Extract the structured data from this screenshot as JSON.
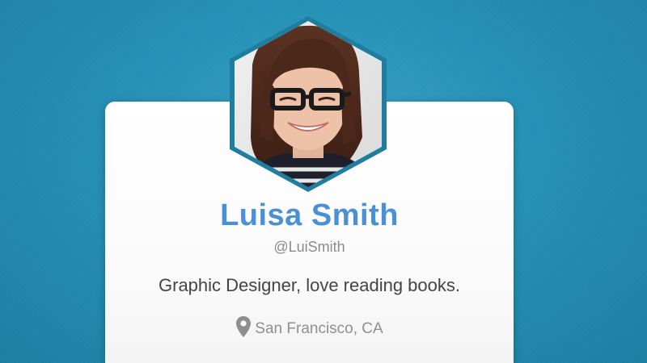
{
  "profile": {
    "name": "Luisa Smith",
    "handle": "@LuiSmith",
    "bio": "Graphic Designer, love reading books.",
    "location": "San Francisco, CA"
  },
  "icons": {
    "location": "map-pin-icon",
    "avatar": "profile-photo"
  },
  "colors": {
    "background": "#2591b6",
    "card": "#ffffff",
    "name": "#4a90d9",
    "hexagon_border": "#1f7e9f"
  }
}
